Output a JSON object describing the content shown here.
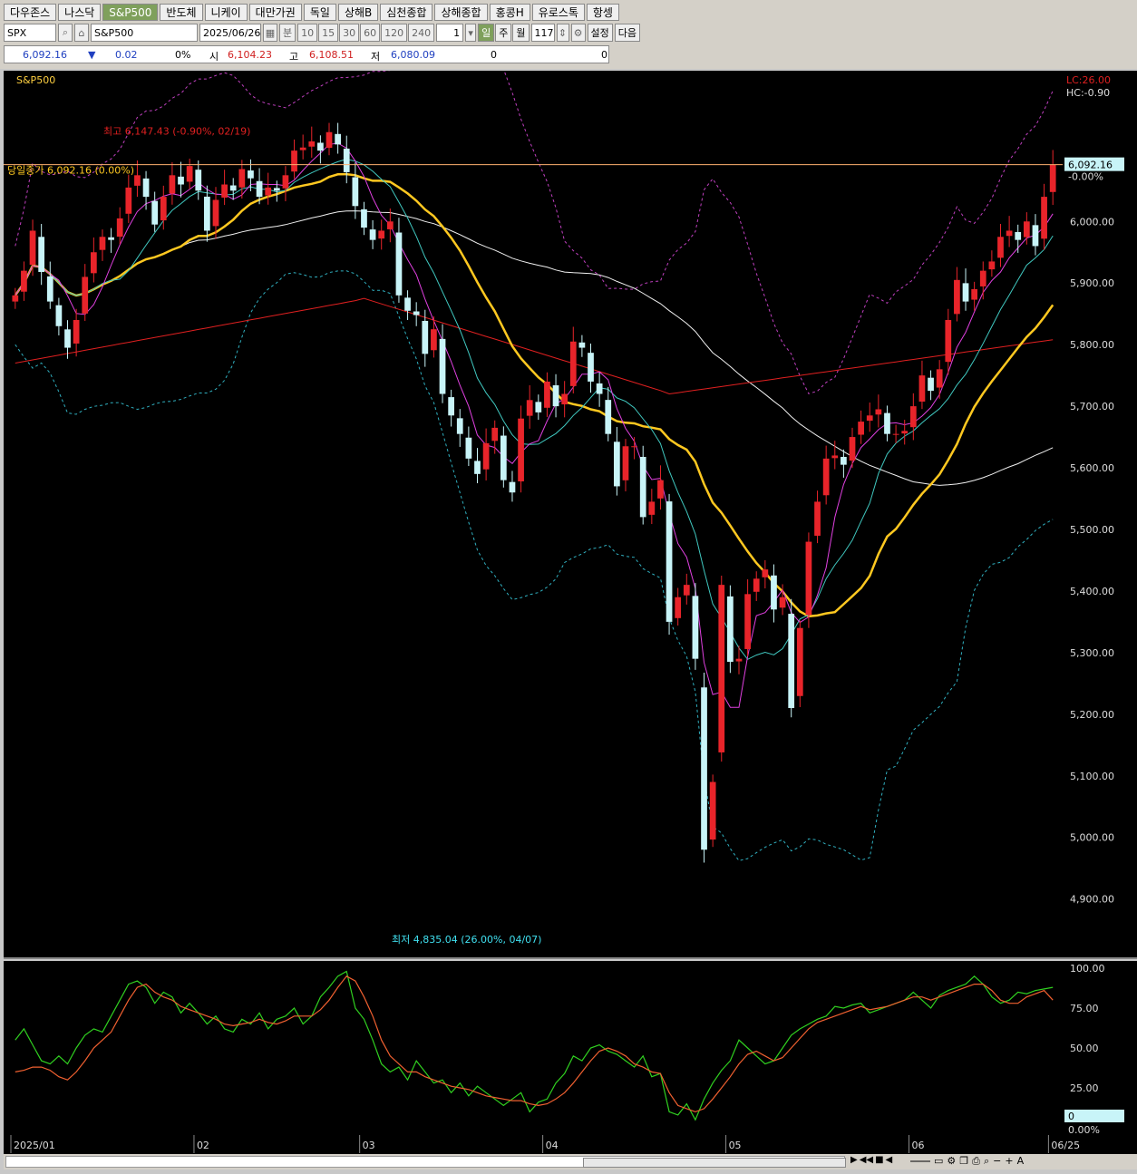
{
  "tabs": [
    "다우존스",
    "나스닥",
    "S&P500",
    "반도체",
    "니케이",
    "대만가권",
    "독일",
    "상해B",
    "심천종합",
    "상해종합",
    "홍콩H",
    "유로스톡",
    "항셍"
  ],
  "active_tab": "S&P500",
  "controls": {
    "symbol": "SPX",
    "name": "S&P500",
    "date": "2025/06/26",
    "unit_label": "분",
    "minute_options": [
      "10",
      "15",
      "30",
      "60",
      "120",
      "240"
    ],
    "count": "1",
    "period_buttons": [
      "일",
      "주",
      "월"
    ],
    "active_period": "일",
    "bars": "117",
    "settings_label": "설정",
    "next_label": "다음"
  },
  "quote": {
    "price": "6,092.16",
    "change_arrow": "▼",
    "change": "0.02",
    "change_pct": "0%",
    "open_label": "시",
    "open": "6,104.23",
    "high_label": "고",
    "high": "6,108.51",
    "low_label": "저",
    "low": "6,080.09",
    "vol1": "0",
    "vol2": "0"
  },
  "colors": {
    "up": "#e8242a",
    "down": "#c8f4f8",
    "ma5": "#e040e0",
    "ma10": "#40c8c0",
    "ma20": "#ffc820",
    "ma60": "#f0f0f0",
    "ma120": "#e02020",
    "band_upper": "#c040c0",
    "band_lower": "#30b0c0",
    "stoch_k": "#30d020",
    "stoch_d": "#f06030",
    "overbought_fill": "#ffb088",
    "oversold_fill": "#40f0f0"
  },
  "chart_data": [
    {
      "type": "candlestick",
      "title": "S&P500",
      "annotations": {
        "high_label": "최고 6,147.43 (-0.90%, 02/19)",
        "low_label": "최저 4,835.04 (26.00%, 04/07)",
        "close_label": "당일종가 6,092.16 (0.00%)",
        "lc": "LC:26.00",
        "hc": "HC:-0.90",
        "last_price": "6,092.16",
        "last_pct": "-0.00%"
      },
      "ylim": [
        4820,
        6230
      ],
      "yticks": [
        4900,
        5000,
        5100,
        5200,
        5300,
        5400,
        5500,
        5600,
        5700,
        5800,
        5900,
        6000
      ],
      "ytick_labels": [
        "4,900.00",
        "5,000.00",
        "5,100.00",
        "5,200.00",
        "5,300.00",
        "5,400.00",
        "5,500.00",
        "5,600.00",
        "5,700.00",
        "5,800.00",
        "5,900.00",
        "6,000.00"
      ],
      "x_labels": [
        {
          "label": "2025/01",
          "index": 0
        },
        {
          "label": "02",
          "index": 21
        },
        {
          "label": "03",
          "index": 40
        },
        {
          "label": "04",
          "index": 61
        },
        {
          "label": "05",
          "index": 82
        },
        {
          "label": "06",
          "index": 103
        },
        {
          "label": "06/25",
          "index": 119
        }
      ],
      "closes": [
        5880,
        5920,
        5985,
        5918,
        5870,
        5830,
        5795,
        5840,
        5910,
        5950,
        5975,
        5970,
        6005,
        6055,
        6075,
        6040,
        5995,
        6040,
        6075,
        6060,
        6090,
        6050,
        5985,
        6035,
        6060,
        6050,
        6085,
        6070,
        6040,
        6055,
        6050,
        6075,
        6115,
        6120,
        6130,
        6115,
        6145,
        6125,
        6080,
        6025,
        5990,
        5970,
        5985,
        6000,
        5880,
        5855,
        5848,
        5785,
        5825,
        5720,
        5685,
        5655,
        5615,
        5590,
        5640,
        5665,
        5580,
        5560,
        5680,
        5710,
        5690,
        5740,
        5700,
        5720,
        5805,
        5795,
        5740,
        5720,
        5655,
        5570,
        5635,
        5635,
        5520,
        5545,
        5580,
        5350,
        5390,
        5410,
        5290,
        4980,
        5090,
        5410,
        5285,
        5290,
        5395,
        5420,
        5435,
        5370,
        5390,
        5210,
        5340,
        5480,
        5545,
        5615,
        5620,
        5605,
        5650,
        5675,
        5685,
        5695,
        5655,
        5655,
        5660,
        5700,
        5750,
        5725,
        5760,
        5840,
        5905,
        5870,
        5890,
        5920,
        5935,
        5975,
        5985,
        5970,
        6000,
        5960,
        6040,
        6092
      ],
      "ma20_endpoints": {
        "start": 5960,
        "low_point": 5390,
        "end": 5980
      },
      "bollinger": {
        "upper_peak": 6190,
        "lower_trough": 5080,
        "end_upper": 6150,
        "end_lower": 5620
      },
      "ma120_range": [
        5760,
        5880
      ]
    },
    {
      "type": "line",
      "title": "",
      "ylim": [
        0,
        100
      ],
      "yticks": [
        25,
        50,
        75,
        100
      ],
      "ytick_labels": [
        "25.00",
        "50.00",
        "75.00",
        "100.00"
      ],
      "last_value": "0",
      "last_pct": "0.00%",
      "series": [
        {
          "values": [
            55,
            62,
            52,
            42,
            40,
            45,
            40,
            50,
            58,
            62,
            60,
            70,
            80,
            90,
            92,
            88,
            78,
            85,
            82,
            72,
            78,
            72,
            65,
            70,
            62,
            60,
            68,
            65,
            72,
            62,
            68,
            70,
            75,
            65,
            70,
            82,
            88,
            95,
            98,
            75,
            68,
            55,
            40,
            35,
            38,
            30,
            42,
            35,
            28,
            30,
            22,
            28,
            20,
            26,
            22,
            18,
            14,
            18,
            22,
            10,
            16,
            18,
            28,
            34,
            45,
            42,
            50,
            52,
            48,
            46,
            42,
            38,
            45,
            32,
            34,
            10,
            8,
            15,
            5,
            18,
            28,
            36,
            42,
            55,
            50,
            45,
            40,
            42,
            50,
            58,
            62,
            65,
            68,
            70,
            76,
            75,
            77,
            78,
            72,
            74,
            76,
            78,
            80,
            85,
            80,
            75,
            83,
            86,
            88,
            90,
            95,
            90,
            82,
            78,
            80,
            85,
            84,
            86,
            87,
            88
          ]
        },
        {
          "values": [
            35,
            36,
            38,
            38,
            36,
            32,
            30,
            35,
            42,
            50,
            55,
            60,
            70,
            80,
            88,
            90,
            85,
            82,
            80,
            76,
            74,
            72,
            70,
            68,
            65,
            64,
            65,
            66,
            68,
            66,
            65,
            67,
            70,
            70,
            70,
            74,
            80,
            88,
            95,
            92,
            82,
            70,
            55,
            45,
            40,
            35,
            35,
            32,
            30,
            28,
            26,
            25,
            24,
            22,
            20,
            19,
            18,
            17,
            17,
            15,
            14,
            15,
            18,
            22,
            28,
            35,
            42,
            48,
            50,
            48,
            45,
            40,
            38,
            35,
            34,
            22,
            14,
            12,
            10,
            12,
            18,
            25,
            32,
            40,
            46,
            48,
            45,
            42,
            44,
            50,
            56,
            62,
            66,
            68,
            70,
            72,
            74,
            76,
            74,
            75,
            76,
            78,
            80,
            82,
            82,
            80,
            82,
            84,
            86,
            88,
            90,
            90,
            86,
            80,
            78,
            78,
            82,
            84,
            86,
            80
          ]
        }
      ]
    }
  ],
  "scroll": {
    "buttons": [
      "▶",
      "◀◀",
      "■",
      "◀"
    ]
  }
}
